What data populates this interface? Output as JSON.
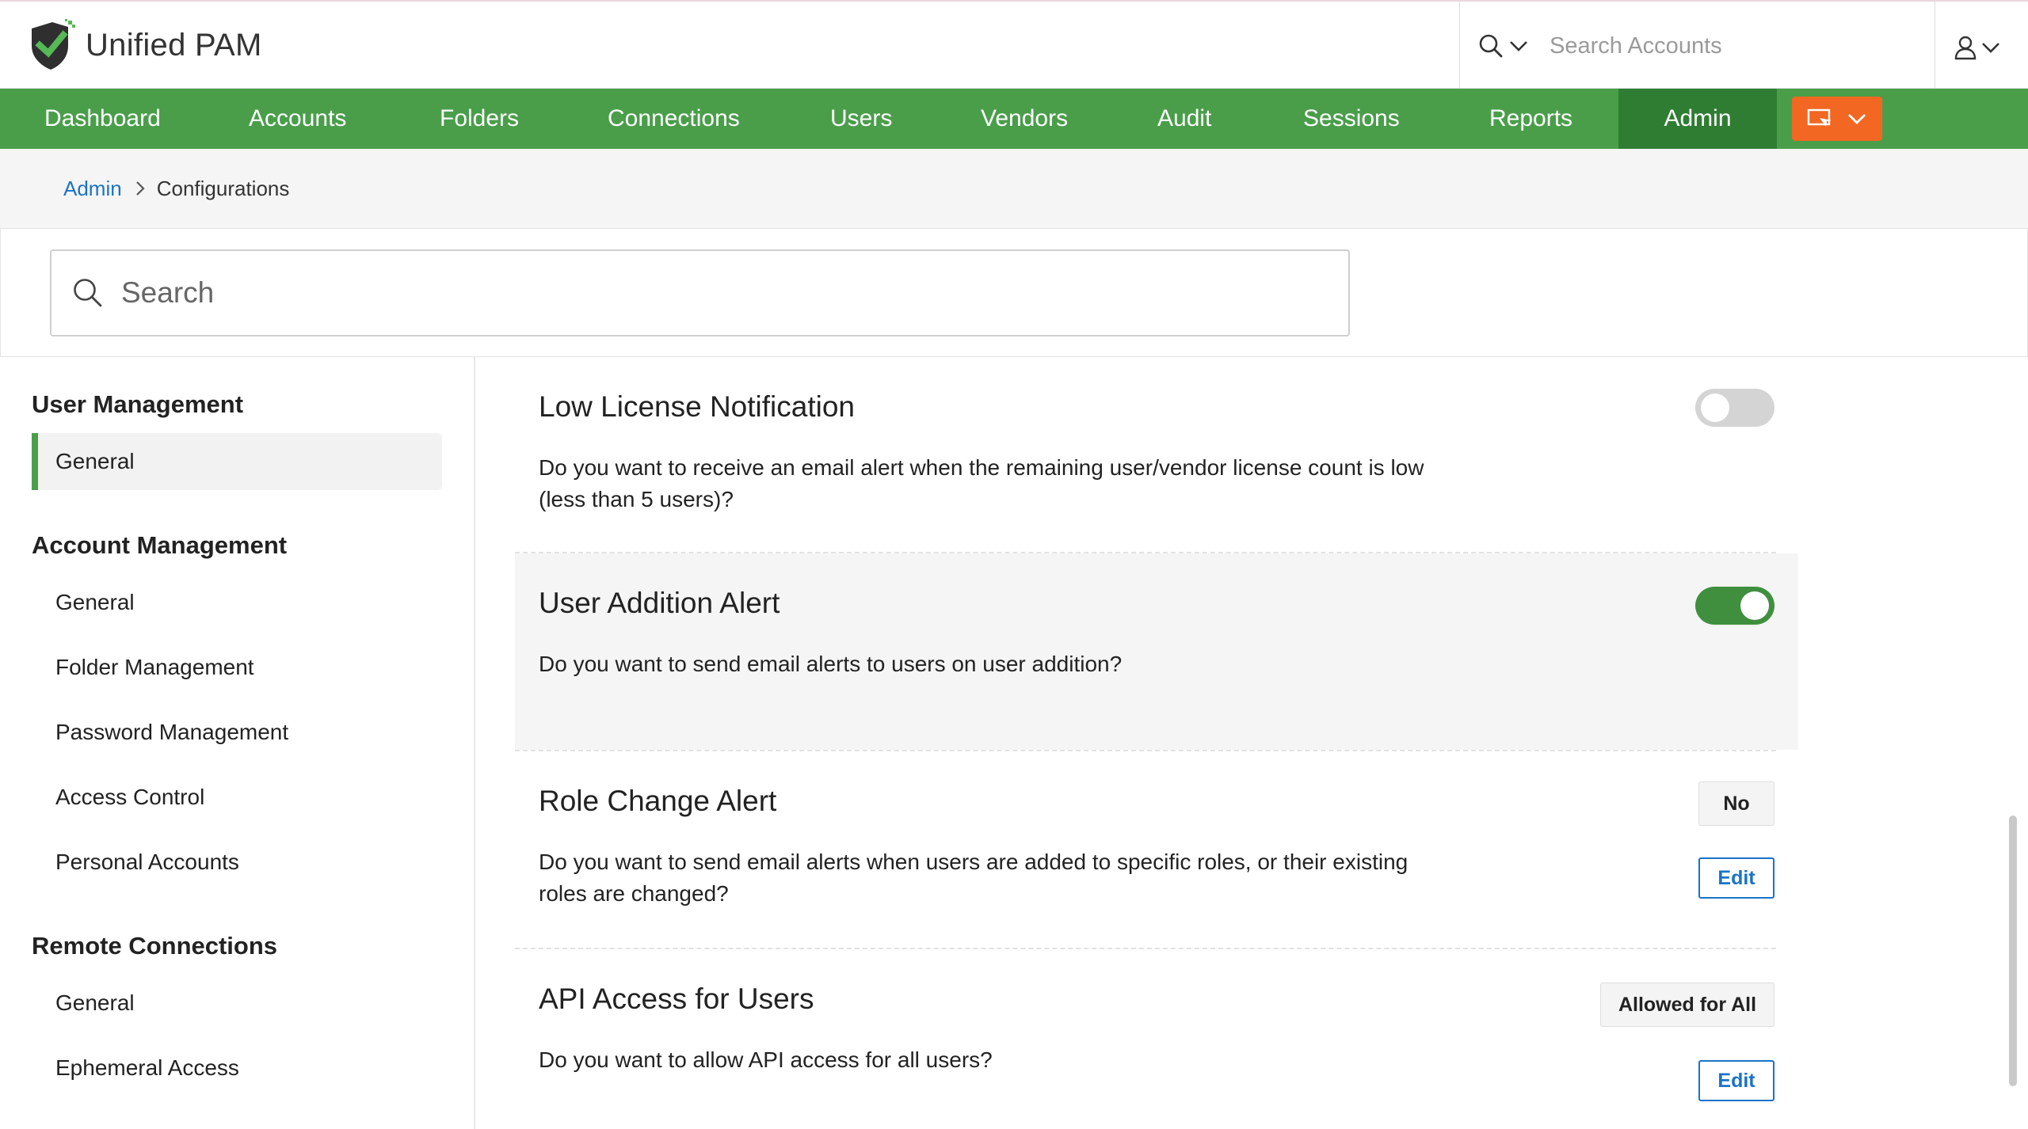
{
  "app": {
    "title": "Unified PAM",
    "brand_color": "#4a9e4a",
    "accent_color": "#f26722",
    "logo_icon": "shield-check-icon"
  },
  "header": {
    "search_placeholder": "Search Accounts",
    "search_icon": "search-icon",
    "user_icon": "user-icon"
  },
  "nav": {
    "items": [
      {
        "label": "Dashboard"
      },
      {
        "label": "Accounts"
      },
      {
        "label": "Folders"
      },
      {
        "label": "Connections"
      },
      {
        "label": "Users"
      },
      {
        "label": "Vendors"
      },
      {
        "label": "Audit"
      },
      {
        "label": "Sessions"
      },
      {
        "label": "Reports"
      },
      {
        "label": "Admin",
        "active": true
      }
    ],
    "action_icon": "remote-screen-icon"
  },
  "breadcrumb": {
    "parent": "Admin",
    "current": "Configurations"
  },
  "page_search": {
    "placeholder": "Search"
  },
  "sidebar": {
    "sections": [
      {
        "heading": "User Management",
        "items": [
          {
            "label": "General",
            "active": true
          }
        ]
      },
      {
        "heading": "Account Management",
        "items": [
          {
            "label": "General"
          },
          {
            "label": "Folder Management"
          },
          {
            "label": "Password Management"
          },
          {
            "label": "Access Control"
          },
          {
            "label": "Personal Accounts"
          }
        ]
      },
      {
        "heading": "Remote Connections",
        "items": [
          {
            "label": "General"
          },
          {
            "label": "Ephemeral Access"
          }
        ]
      }
    ]
  },
  "settings": [
    {
      "title": "Low License Notification",
      "description": "Do you want to receive an email alert when the remaining user/vendor license count is low (less than 5 users)?",
      "toggle": false
    },
    {
      "title": "User Addition Alert",
      "description": "Do you want to send email alerts to users on user addition?",
      "toggle": true
    },
    {
      "title": "Role Change Alert",
      "description": "Do you want to send email alerts when users are added to specific roles, or their existing roles are changed?",
      "value": "No",
      "edit_label": "Edit"
    },
    {
      "title": "API Access for Users",
      "description": "Do you want to allow API access for all users?",
      "value": "Allowed for All",
      "edit_label": "Edit"
    }
  ]
}
